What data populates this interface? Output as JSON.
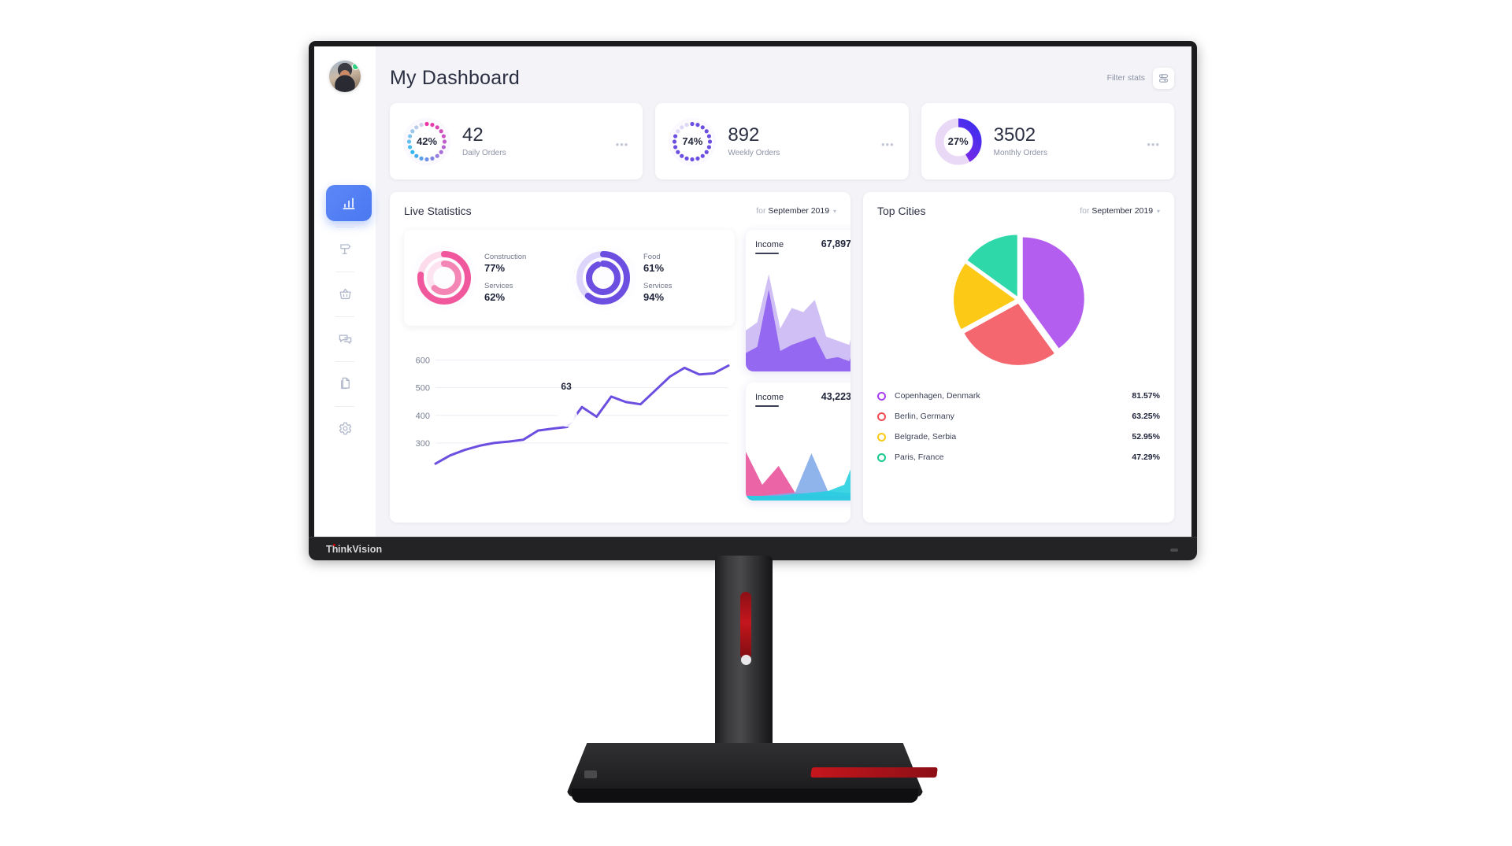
{
  "device": {
    "brand": "ThinkVision"
  },
  "header": {
    "title": "My Dashboard",
    "filter_label": "Filter stats",
    "filter_icon": "sliders-icon",
    "avatar_name": "user-avatar",
    "status": "online"
  },
  "sidebar": {
    "items": [
      {
        "name": "sidebar-item-analytics",
        "icon": "bar-chart-icon",
        "active": true
      },
      {
        "name": "sidebar-item-campaigns",
        "icon": "signpost-icon",
        "active": false
      },
      {
        "name": "sidebar-item-orders",
        "icon": "basket-icon",
        "active": false
      },
      {
        "name": "sidebar-item-messages",
        "icon": "chat-bubble-icon",
        "active": false
      },
      {
        "name": "sidebar-item-documents",
        "icon": "document-icon",
        "active": false
      },
      {
        "name": "sidebar-item-settings",
        "icon": "gear-icon",
        "active": false
      }
    ]
  },
  "kpis": [
    {
      "percent": "42%",
      "percent_value": 42,
      "value": "42",
      "label": "Daily Orders",
      "style": "dotted-gradient-pink-blue",
      "menu": "•••"
    },
    {
      "percent": "74%",
      "percent_value": 74,
      "value": "892",
      "label": "Weekly Orders",
      "style": "dotted-purple",
      "menu": "•••"
    },
    {
      "percent": "27%",
      "percent_value": 27,
      "value": "3502",
      "label": "Monthly Orders",
      "style": "solid-arc-violet",
      "menu": "•••"
    }
  ],
  "live_statistics": {
    "title": "Live Statistics",
    "period_prefix": "for",
    "period": "September 2019",
    "caret": "▾",
    "donuts": [
      {
        "color": "#f0579c",
        "outer": {
          "label": "Construction",
          "value": "77%",
          "percent": 77
        },
        "inner": {
          "label": "Services",
          "value": "62%",
          "percent": 62
        }
      },
      {
        "color": "#6c4fe0",
        "outer": {
          "label": "Food",
          "value": "61%",
          "percent": 61
        },
        "inner": {
          "label": "Services",
          "value": "94%",
          "percent": 94
        }
      }
    ],
    "tooltip_value": "63",
    "chart_data": {
      "type": "line",
      "title": "Live Statistics",
      "xlabel": "",
      "ylabel": "",
      "ylim": [
        200,
        650
      ],
      "yticks": [
        "300",
        "400",
        "500",
        "600"
      ],
      "ytick_values": [
        300,
        400,
        500,
        600
      ],
      "grid": true,
      "legend": "none",
      "line_color": "#6c4fe0",
      "annotation": {
        "label": "63",
        "x_index": 9,
        "y": 395
      },
      "x": [
        0,
        1,
        2,
        3,
        4,
        5,
        6,
        7,
        8,
        9,
        10,
        11,
        12,
        13,
        14,
        15,
        16,
        17,
        18,
        19
      ],
      "values": [
        225,
        255,
        275,
        290,
        300,
        305,
        312,
        345,
        352,
        358,
        430,
        395,
        468,
        448,
        440,
        490,
        540,
        572,
        548,
        552,
        580
      ]
    }
  },
  "income_cards": [
    {
      "name": "Income",
      "value": "67,897",
      "chart_data": {
        "type": "area",
        "title": "Income",
        "series": [
          {
            "name": "upper",
            "color": "#c9b6f2",
            "values": [
              40,
              48,
              95,
              42,
              62,
              58,
              70,
              34,
              30,
              26,
              72
            ]
          },
          {
            "name": "lower",
            "color": "#8b5cf0",
            "values": [
              18,
              24,
              80,
              20,
              26,
              30,
              34,
              12,
              14,
              10,
              40
            ]
          }
        ],
        "x": [
          0,
          1,
          2,
          3,
          4,
          5,
          6,
          7,
          8,
          9,
          10
        ],
        "ylim": [
          0,
          100
        ],
        "grid": false,
        "legend": "none"
      }
    },
    {
      "name": "Income",
      "value": "43,223",
      "chart_data": {
        "type": "area",
        "title": "Income",
        "series": [
          {
            "name": "pink",
            "color": "#e84f9a",
            "values": [
              62,
              20,
              44,
              10,
              8,
              6,
              6,
              6
            ]
          },
          {
            "name": "blue",
            "color": "#7fa8e8",
            "values": [
              6,
              6,
              8,
              10,
              60,
              12,
              10,
              8
            ]
          },
          {
            "name": "cyan",
            "color": "#22cfe0",
            "values": [
              6,
              6,
              6,
              8,
              10,
              12,
              20,
              72
            ]
          }
        ],
        "x": [
          0,
          1,
          2,
          3,
          4,
          5,
          6,
          7
        ],
        "ylim": [
          0,
          100
        ],
        "grid": false,
        "legend": "none"
      }
    }
  ],
  "top_cities": {
    "title": "Top Cities",
    "period_prefix": "for",
    "period": "September 2019",
    "caret": "▾",
    "chart_data": {
      "type": "pie",
      "title": "Top Cities",
      "labels": [
        "Copenhagen, Denmark",
        "Berlin, Germany",
        "Belgrade, Serbia",
        "Paris, France"
      ],
      "values": [
        40,
        27,
        18,
        15
      ],
      "display_values": [
        "81.57%",
        "63.25%",
        "52.95%",
        "47.29%"
      ],
      "colors": [
        "#b45ef0",
        "#f4676e",
        "#fbc916",
        "#2fd8a8"
      ],
      "exploded": true,
      "legend": "bottom"
    },
    "legend": [
      {
        "name": "Copenhagen, Denmark",
        "pct": "81.57%",
        "color": "#a93ef0"
      },
      {
        "name": "Berlin, Germany",
        "pct": "63.25%",
        "color": "#ef4b52"
      },
      {
        "name": "Belgrade, Serbia",
        "pct": "52.95%",
        "color": "#fbc916"
      },
      {
        "name": "Paris, France",
        "pct": "47.29%",
        "color": "#17c98a"
      }
    ]
  }
}
